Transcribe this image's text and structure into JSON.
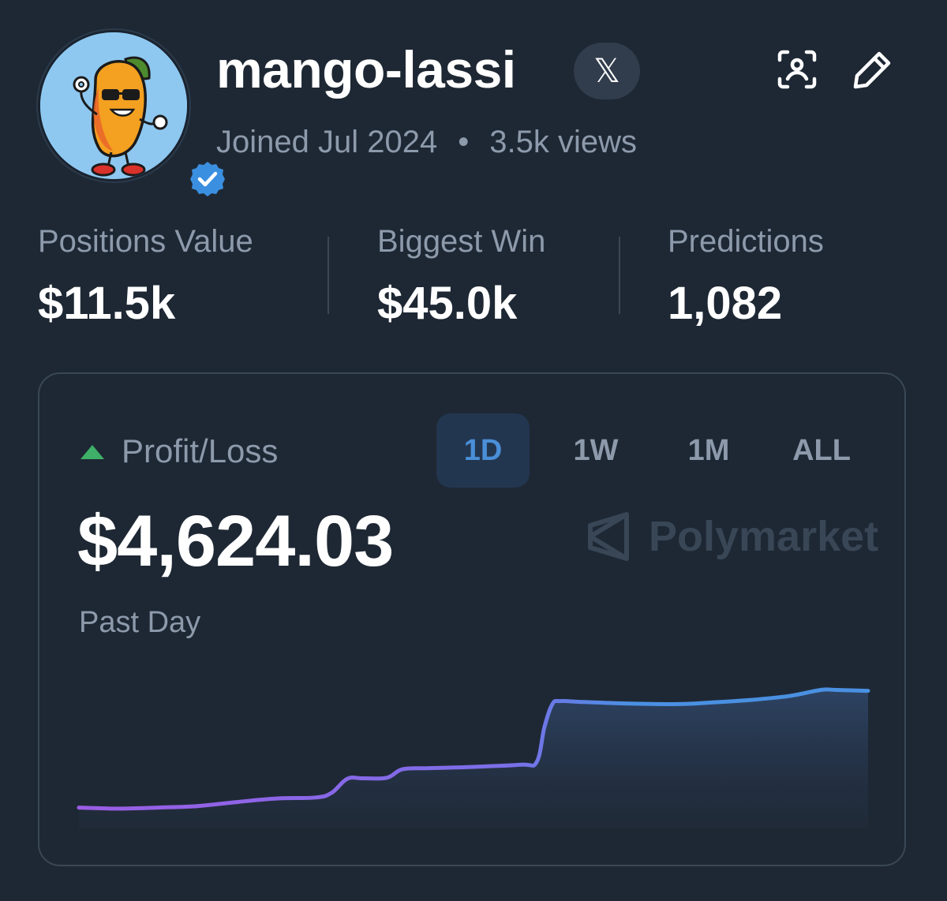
{
  "profile": {
    "username": "mango-lassi",
    "x_icon_label": "𝕏",
    "joined": "Joined Jul 2024",
    "separator": "•",
    "views": "3.5k views",
    "verified": true
  },
  "stats": [
    {
      "label": "Positions Value",
      "value": "$11.5k"
    },
    {
      "label": "Biggest Win",
      "value": "$45.0k"
    },
    {
      "label": "Predictions",
      "value": "1,082"
    }
  ],
  "pnl": {
    "label": "Profit/Loss",
    "value": "$4,624.03",
    "period": "Past Day",
    "trend": "up",
    "brand": "Polymarket",
    "tabs": [
      {
        "label": "1D",
        "active": true
      },
      {
        "label": "1W",
        "active": false
      },
      {
        "label": "1M",
        "active": false
      },
      {
        "label": "ALL",
        "active": false
      }
    ]
  },
  "colors": {
    "background": "#1e2834",
    "accent_blue": "#4a8fd8",
    "positive_green": "#3fb068",
    "line_start": "#9b5de5",
    "line_end": "#4a90e2",
    "muted_text": "#8d9aab"
  },
  "icons": {
    "scan": "scan-profile-icon",
    "edit": "pencil-icon",
    "verified": "verified-check-icon",
    "brand": "polymarket-logo-icon"
  },
  "chart_data": {
    "type": "area",
    "title": "",
    "xlabel": "",
    "ylabel": "",
    "x": [
      0,
      5,
      10,
      15,
      20,
      25,
      30,
      32,
      34,
      36,
      39,
      41,
      44,
      49,
      56,
      58,
      59,
      60,
      61,
      64,
      70,
      76,
      80,
      85,
      90,
      94,
      96,
      100
    ],
    "series": [
      {
        "values": [
          0,
          -40,
          0,
          60,
          220,
          360,
          400,
          580,
          1140,
          1160,
          1180,
          1520,
          1560,
          1600,
          1700,
          1800,
          3200,
          4100,
          4220,
          4180,
          4120,
          4100,
          4160,
          4260,
          4420,
          4660,
          4660,
          4624
        ]
      }
    ],
    "ylim": [
      -200,
      4800
    ],
    "grid": false
  }
}
